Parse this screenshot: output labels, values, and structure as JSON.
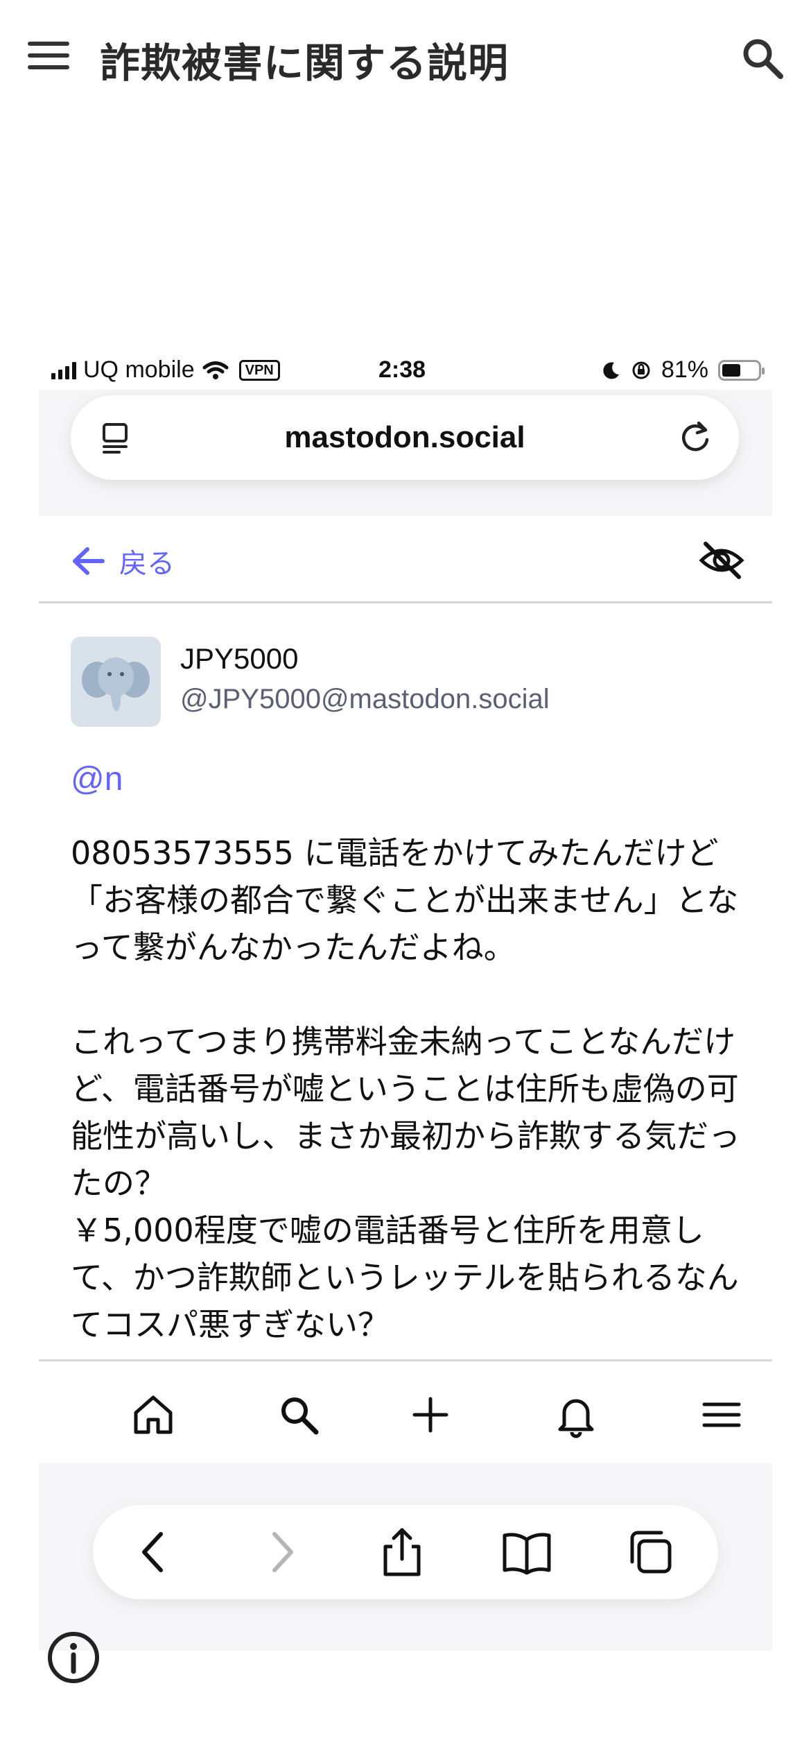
{
  "app_header": {
    "title": "詐欺被害に関する説明",
    "menu_icon": "hamburger-menu-icon",
    "search_icon": "search-icon"
  },
  "status_bar": {
    "carrier": "UQ mobile",
    "vpn": "VPN",
    "time": "2:38",
    "battery": "81%"
  },
  "browser": {
    "url": "mastodon.social"
  },
  "nav": {
    "back_label": "戻る",
    "accent_color": "#6364ff"
  },
  "post": {
    "display_name": "JPY5000",
    "account": "@JPY5000@mastodon.social",
    "mention": "@n",
    "paragraphs": [
      "08053573555 に電話をかけてみたんだけど「お客様の都合で繋ぐことが出来ません」となって繋がんなかったんだよね。",
      "これってつまり携帯料金未納ってことなんだけど、電話番号が嘘ということは住所も虚偽の可能性が高いし、まさか最初から詐欺する気だったの？",
      "￥5,000程度で嘘の電話番号と住所を用意して、かつ詐欺師というレッテルを貼られるなんてコスパ悪すぎない？"
    ]
  },
  "tab_bar": {
    "items": [
      "home-icon",
      "search-icon",
      "compose-icon",
      "notifications-icon",
      "menu-icon"
    ]
  },
  "browser_toolbar": {
    "items": [
      "back-icon",
      "forward-icon",
      "share-icon",
      "bookmarks-icon",
      "tabs-icon"
    ]
  },
  "footer": {
    "info_icon": "info-icon"
  }
}
